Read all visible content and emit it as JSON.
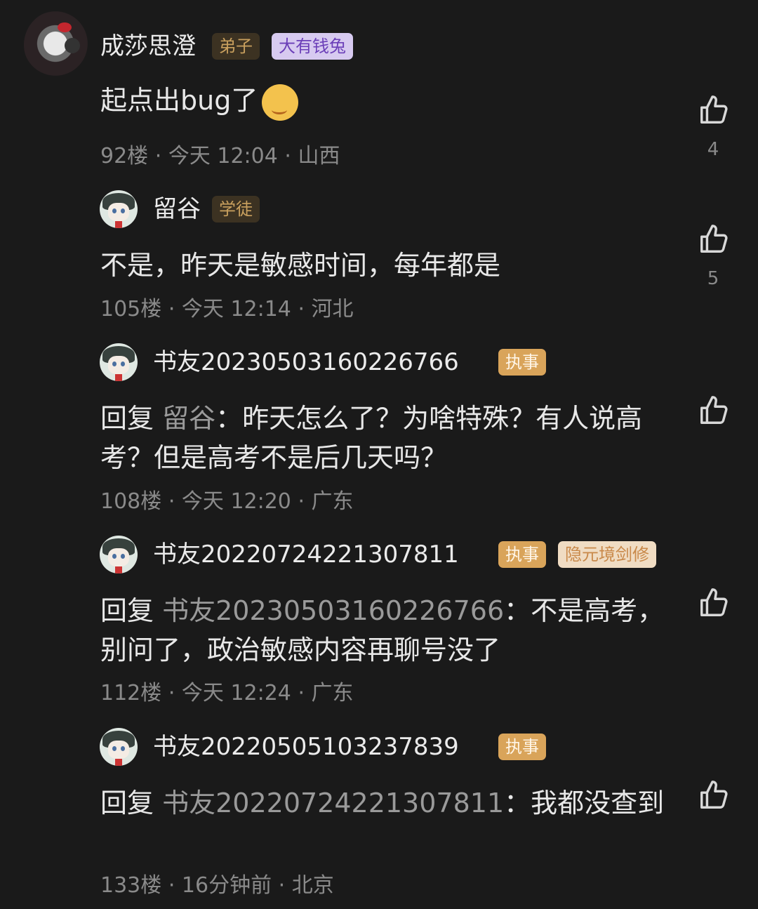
{
  "comments": [
    {
      "username": "成莎思澄",
      "badges": [
        "弟子",
        "大有钱兔"
      ],
      "text": "起点出bug了",
      "floor": "92楼",
      "time": "今天 12:04",
      "location": "山西",
      "likes": "4"
    },
    {
      "username": "留谷",
      "badges": [
        "学徒"
      ],
      "text": "不是，昨天是敏感时间，每年都是",
      "floor": "105楼",
      "time": "今天 12:14",
      "location": "河北",
      "likes": "5"
    },
    {
      "username": "书友20230503160226766",
      "badges": [
        "执事"
      ],
      "reply_prefix": "回复",
      "reply_to": "留谷",
      "text": "：昨天怎么了？为啥特殊？有人说高考？但是高考不是后几天吗？",
      "floor": "108楼",
      "time": "今天 12:20",
      "location": "广东"
    },
    {
      "username": "书友20220724221307811",
      "badges": [
        "执事",
        "隐元境剑修"
      ],
      "reply_prefix": "回复",
      "reply_to": "书友20230503160226766",
      "text": "：不是高考，别问了，政治敏感内容再聊号没了",
      "floor": "112楼",
      "time": "今天 12:24",
      "location": "广东"
    },
    {
      "username": "书友20220505103237839",
      "badges": [
        "执事"
      ],
      "reply_prefix": "回复",
      "reply_to": "书友20220724221307811",
      "text": "：我都没查到",
      "floor": "133楼",
      "time": "16分钟前",
      "location": "北京"
    }
  ],
  "separator": "·",
  "icons": {
    "like": "thumbs-up-icon",
    "emoji": "smiling-face-emoji"
  }
}
